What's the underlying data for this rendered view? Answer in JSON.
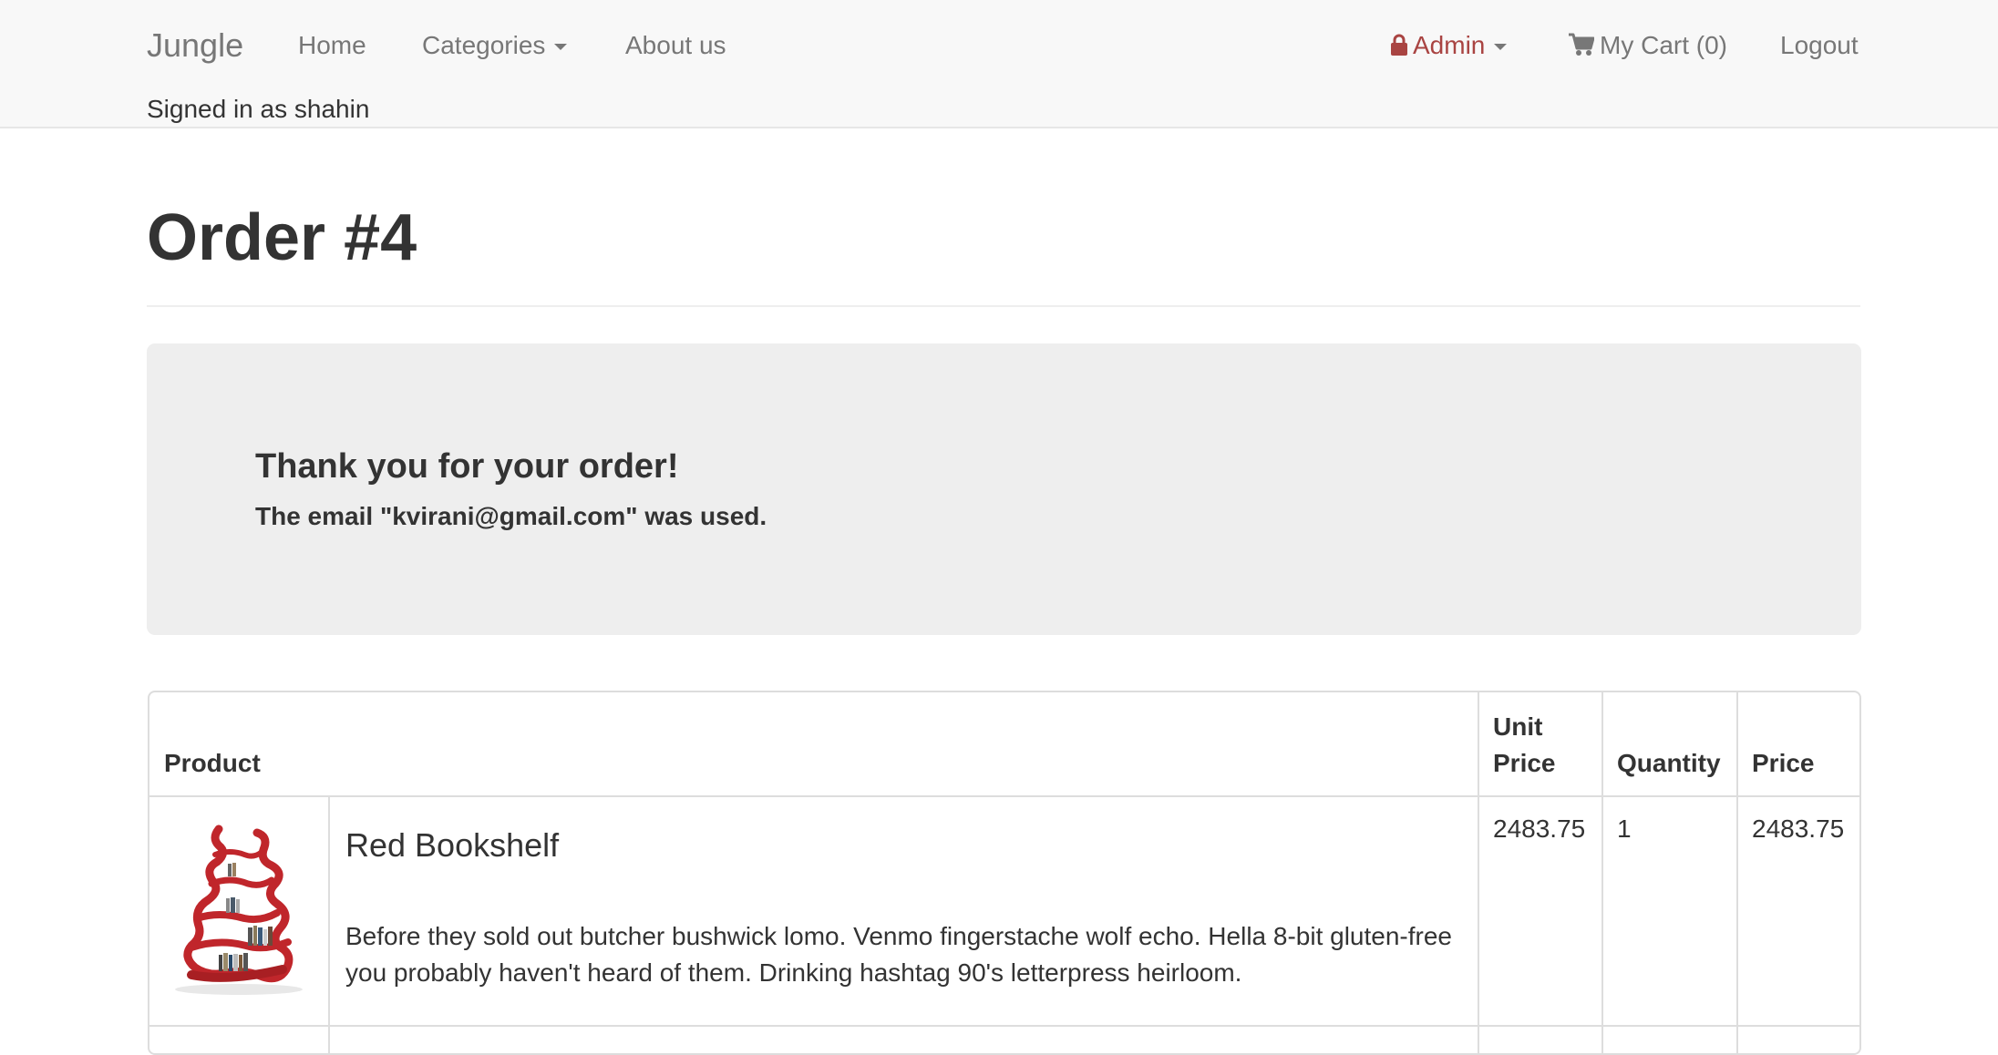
{
  "navbar": {
    "brand": "Jungle",
    "home": "Home",
    "categories": "Categories",
    "about": "About us",
    "admin": "Admin",
    "cart": "My Cart (0)",
    "logout": "Logout",
    "signed_in": "Signed in as shahin"
  },
  "page": {
    "title": "Order #4"
  },
  "jumbotron": {
    "heading": "Thank you for your order!",
    "subtext": "The email \"kvirani@gmail.com\" was used."
  },
  "table": {
    "headers": {
      "product": "Product",
      "unit_price_1": "Unit",
      "unit_price_2": "Price",
      "quantity": "Quantity",
      "price": "Price"
    },
    "rows": [
      {
        "name": "Red Bookshelf",
        "description": "Before they sold out butcher bushwick lomo. Venmo fingerstache wolf echo. Hella 8-bit gluten-free you probably haven't heard of them. Drinking hashtag 90's letterpress heirloom.",
        "unit_price": "2483.75",
        "quantity": "1",
        "price": "2483.75"
      }
    ]
  },
  "colors": {
    "navbar_bg": "#f8f8f8",
    "admin_red": "#a94442",
    "jumbotron_bg": "#eeeeee",
    "border": "#dddddd"
  },
  "icons": {
    "admin": "lock-icon",
    "cart": "shopping-cart-icon",
    "dropdown": "caret-down-icon"
  }
}
